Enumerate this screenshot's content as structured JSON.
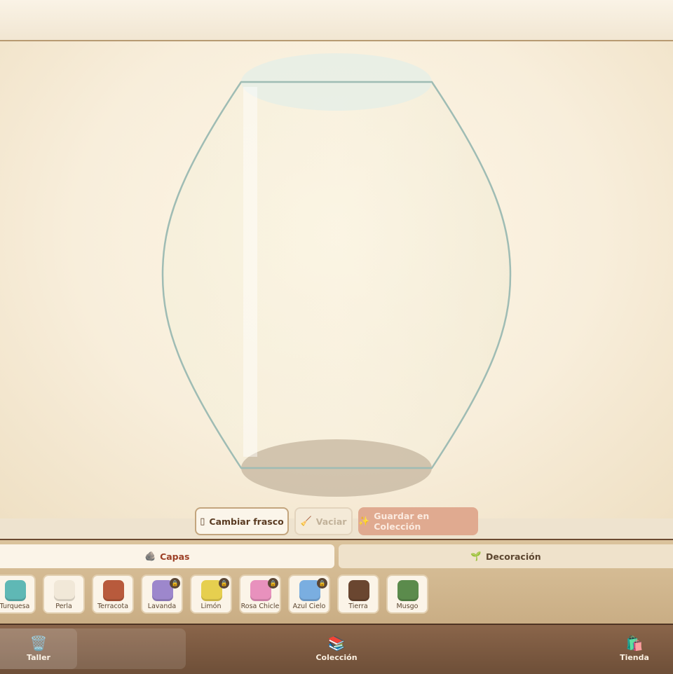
{
  "actions": {
    "change_jar": {
      "icon": "jar-icon",
      "label": "Cambiar frasco"
    },
    "empty": {
      "icon": "broom-icon",
      "label": "Vaciar"
    },
    "save": {
      "icon": "sparkles-icon",
      "label": "Guardar en Colección"
    }
  },
  "tabs": [
    {
      "icon": "rock-icon",
      "label": "Capas",
      "active": true
    },
    {
      "icon": "sprout-icon",
      "label": "Decoración",
      "active": false
    }
  ],
  "swatches": [
    {
      "label": "Turquesa",
      "color": "#5fb8b5",
      "locked": false
    },
    {
      "label": "Perla",
      "color": "#f1e8d8",
      "locked": false
    },
    {
      "label": "Terracota",
      "color": "#b85a3c",
      "locked": false
    },
    {
      "label": "Lavanda",
      "color": "#9d87cc",
      "locked": true
    },
    {
      "label": "Limón",
      "color": "#e6cf4f",
      "locked": true
    },
    {
      "label": "Rosa Chicle",
      "color": "#e891bd",
      "locked": true
    },
    {
      "label": "Azul Cielo",
      "color": "#7aaee0",
      "locked": true
    },
    {
      "label": "Tierra",
      "color": "#6a4630",
      "locked": false
    },
    {
      "label": "Musgo",
      "color": "#5b8b4c",
      "locked": false
    }
  ],
  "nav": [
    {
      "icon": "trash-can-icon",
      "label": "Taller",
      "active": true
    },
    {
      "icon": "books-icon",
      "label": "Colección",
      "active": false
    },
    {
      "icon": "shopping-bags-icon",
      "label": "Tienda",
      "active": false
    }
  ],
  "colors": {
    "accent": "#9c3f25",
    "jar_stroke": "#9fbcb4",
    "save_button": "#e0aa90",
    "nav_bar": "#7b5a41"
  }
}
